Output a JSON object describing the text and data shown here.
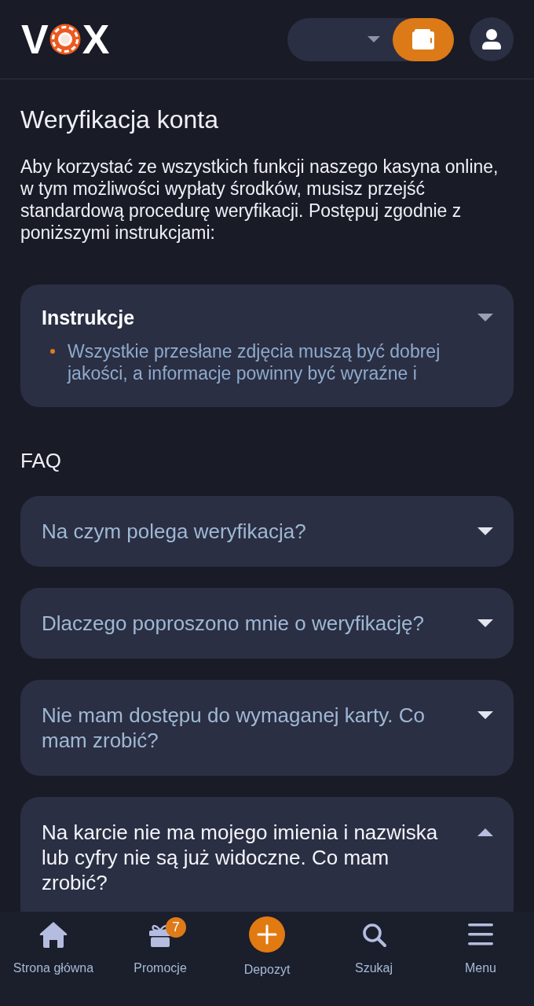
{
  "header": {
    "logo": {
      "letters_left": "V",
      "letters_right": "X"
    }
  },
  "page": {
    "title": "Weryfikacja konta",
    "intro": "Aby korzystać ze wszystkich funkcji naszego kasyna online, w tym możliwości wypłaty środków, musisz przejść standardową procedurę weryfikacji. Postępuj zgodnie z poniższymi instrukcjami:"
  },
  "instructions": {
    "title": "Instrukcje",
    "expanded": false,
    "items": [
      "Wszystkie przesłane zdjęcia muszą być dobrej jakości, a informacje powinny być wyraźne i"
    ]
  },
  "faq": {
    "heading": "FAQ",
    "items": [
      {
        "question": "Na czym polega weryfikacja?",
        "expanded": false
      },
      {
        "question": "Dlaczego poproszono mnie o weryfikację?",
        "expanded": false
      },
      {
        "question": "Nie mam dostępu do wymaganej karty. Co mam zrobić?",
        "expanded": false
      },
      {
        "question": "Na karcie nie ma mojego imienia i nazwiska lub cyfry nie są już widoczne. Co mam zrobić?",
        "expanded": true
      }
    ]
  },
  "bottom_nav": [
    {
      "label": "Strona główna",
      "kind": "tab"
    },
    {
      "label": "Promocje",
      "kind": "tab",
      "badge": "7"
    },
    {
      "label": "Depozyt",
      "kind": "action"
    },
    {
      "label": "Szukaj",
      "kind": "tab"
    },
    {
      "label": "Menu",
      "kind": "tab"
    }
  ]
}
